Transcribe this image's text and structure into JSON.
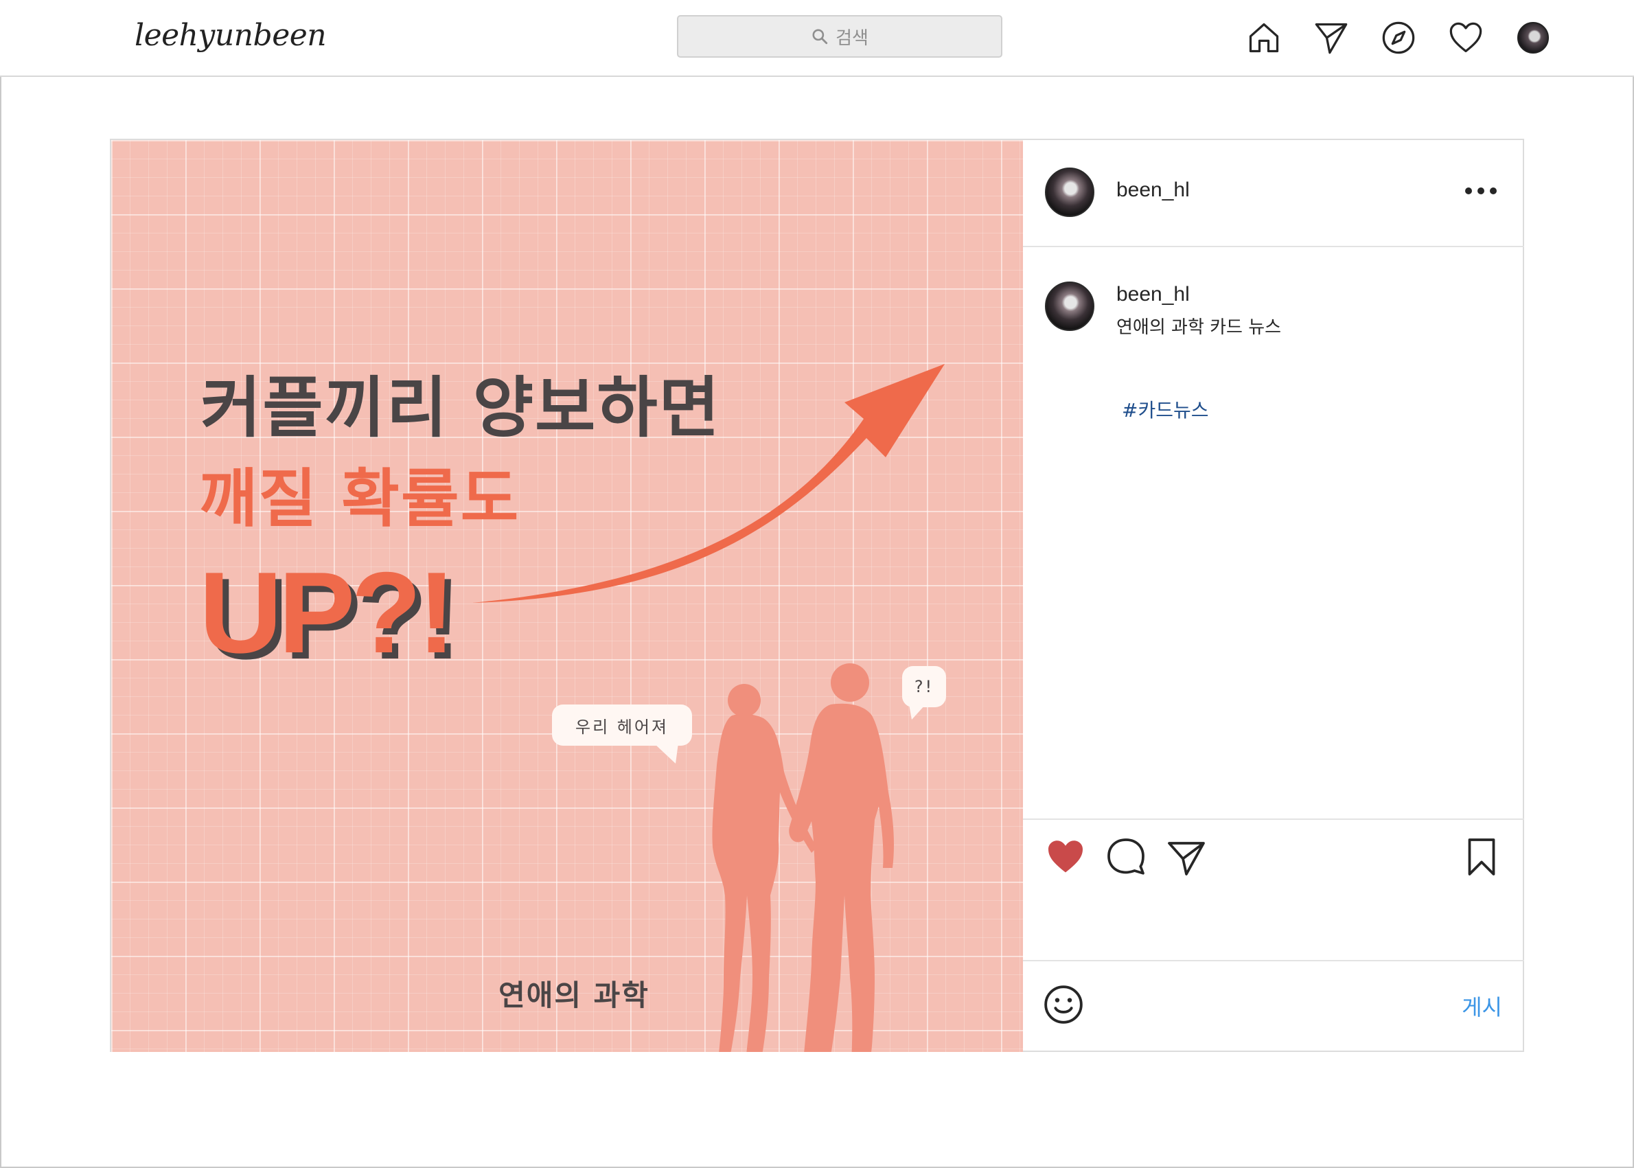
{
  "app": {
    "logo_text": "leehyunbeen"
  },
  "search": {
    "placeholder": "검색"
  },
  "nav": [
    "home-icon",
    "direct-message-icon",
    "explore-compass-icon",
    "activity-heart-icon",
    "profile-avatar"
  ],
  "post": {
    "username": "been_hl",
    "image": {
      "headline_line1": "커플끼리 양보하면",
      "headline_line2": "깨질 확률도",
      "headline_line3": "UP?!",
      "bubble_left": "우리 헤어져",
      "bubble_right": "?!",
      "footer_text": "연애의 과학"
    },
    "caption": {
      "username": "been_hl",
      "text": "연애의 과학 카드 뉴스",
      "hashtag": "#카드뉴스"
    },
    "actions": {
      "liked": true,
      "like_color": "#e04b4b"
    },
    "comment": {
      "post_label": "게시"
    }
  },
  "colors": {
    "accent_coral": "#ef6a4b",
    "image_bg": "#f5bfb4",
    "text_dark": "#4a4546",
    "link_blue": "#3b95e6",
    "hashtag_blue": "#1f4e8c"
  }
}
